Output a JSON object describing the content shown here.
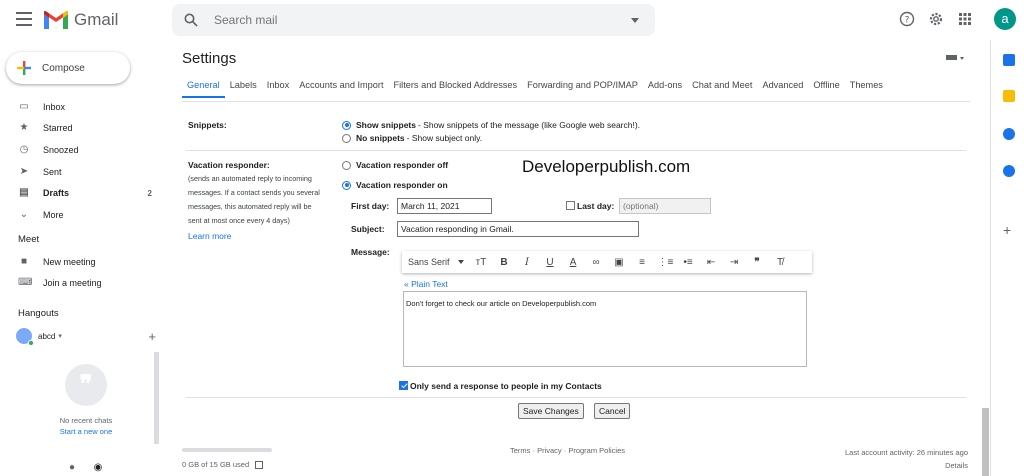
{
  "header": {
    "app_name": "Gmail",
    "search_placeholder": "Search mail",
    "avatar_letter": "a",
    "icons": [
      "help-icon",
      "gear-icon",
      "apps-icon"
    ]
  },
  "sidebar": {
    "compose_label": "Compose",
    "items": [
      {
        "label": "Inbox",
        "icon": "inbox-icon",
        "count": ""
      },
      {
        "label": "Starred",
        "icon": "star-icon",
        "count": ""
      },
      {
        "label": "Snoozed",
        "icon": "clock-icon",
        "count": ""
      },
      {
        "label": "Sent",
        "icon": "send-icon",
        "count": ""
      },
      {
        "label": "Drafts",
        "icon": "draft-icon",
        "count": "2"
      },
      {
        "label": "More",
        "icon": "chevron-down-icon",
        "count": ""
      }
    ],
    "meet": {
      "title": "Meet",
      "items": [
        {
          "label": "New meeting",
          "icon": "video-icon"
        },
        {
          "label": "Join a meeting",
          "icon": "keyboard-icon"
        }
      ]
    },
    "hangouts": {
      "title": "Hangouts",
      "user": "abcd",
      "no_chats": "No recent chats",
      "start_new": "Start a new one"
    }
  },
  "settings": {
    "title": "Settings",
    "tabs": [
      "General",
      "Labels",
      "Inbox",
      "Accounts and Import",
      "Filters and Blocked Addresses",
      "Forwarding and POP/IMAP",
      "Add-ons",
      "Chat and Meet",
      "Advanced",
      "Offline",
      "Themes"
    ],
    "active_tab": "General",
    "snippets": {
      "label": "Snippets:",
      "option1_bold": "Show snippets",
      "option1_rest": " - Show snippets of the message (like Google web search!).",
      "option2_bold": "No snippets",
      "option2_rest": " - Show subject only.",
      "selected": "Show snippets"
    },
    "vacation": {
      "label": "Vacation responder:",
      "description_lines": [
        "(sends an automated reply to incoming",
        "messages. If a contact sends you several",
        "messages, this automated reply will be",
        "sent at most once every 4 days)"
      ],
      "learn_more": "Learn more",
      "off_label": "Vacation responder off",
      "on_label": "Vacation responder on",
      "selected": "Vacation responder on",
      "first_day_label": "First day:",
      "first_day_value": "March 11, 2021",
      "last_day_label": "Last day:",
      "last_day_placeholder": "(optional)",
      "subject_label": "Subject:",
      "subject_value": "Vacation responding in Gmail.",
      "message_label": "Message:",
      "font_name": "Sans Serif",
      "plain_text_link": "« Plain Text",
      "message_body": "Don't forget to check our article on Developerpublish.com",
      "contacts_only_label": "Only send a response to people in my Contacts",
      "contacts_only_checked": true
    },
    "save_label": "Save Changes",
    "cancel_label": "Cancel",
    "watermark": "Developerpublish.com"
  },
  "footer": {
    "storage": "0 GB of 15 GB used",
    "links": "Terms · Privacy · Program Policies",
    "activity": "Last account activity: 26 minutes ago",
    "details": "Details"
  },
  "colors": {
    "accent": "#1a73e8",
    "avatar": "#009688"
  }
}
